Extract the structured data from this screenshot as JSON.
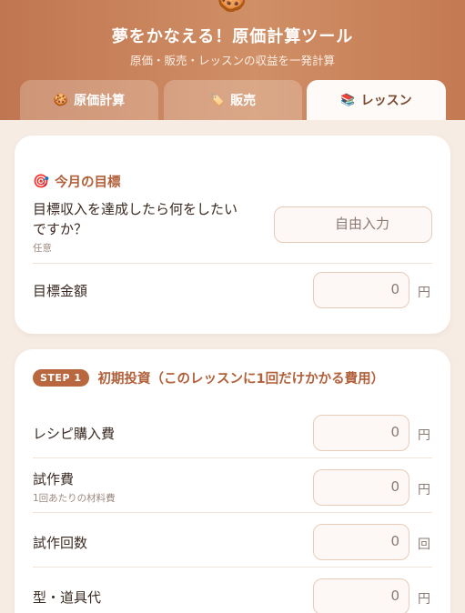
{
  "header": {
    "logo_icon": "cookie-icon",
    "logo_glyph": "🍪",
    "title": "夢をかなえる！原価計算ツール",
    "subtitle": "原価・販売・レッスンの収益を一発計算"
  },
  "tabs": [
    {
      "label": "原価計算",
      "icon": "🍪",
      "active": false
    },
    {
      "label": "販売",
      "icon": "🏷️",
      "active": false
    },
    {
      "label": "レッスン",
      "icon": "📚",
      "active": true
    }
  ],
  "goal_card": {
    "icon": "🎯",
    "title": "今月の目標",
    "dream_label": "目標収入を達成したら何をしたいですか？",
    "dream_label_line1": "目標収入を達成したら何をしたい",
    "dream_label_line2": "ですか？",
    "dream_sub": "任意",
    "dream_placeholder": "自由入力",
    "amount_label": "目標金額",
    "amount_value": "0",
    "amount_unit": "円"
  },
  "step1_card": {
    "badge": "STEP 1",
    "title": "初期投資（このレッスンに1回だけかかる費用）",
    "rows": [
      {
        "label": "レシピ購入費",
        "sub": "",
        "value": "0",
        "unit": "円"
      },
      {
        "label": "試作費",
        "sub": "1回あたりの材料費",
        "value": "0",
        "unit": "円"
      },
      {
        "label": "試作回数",
        "sub": "",
        "value": "0",
        "unit": "回"
      },
      {
        "label": "型・道具代",
        "sub": "",
        "value": "0",
        "unit": "円"
      }
    ]
  },
  "colors": {
    "accent": "#b8673f",
    "header_start": "#c07650",
    "header_end": "#d08f66"
  }
}
